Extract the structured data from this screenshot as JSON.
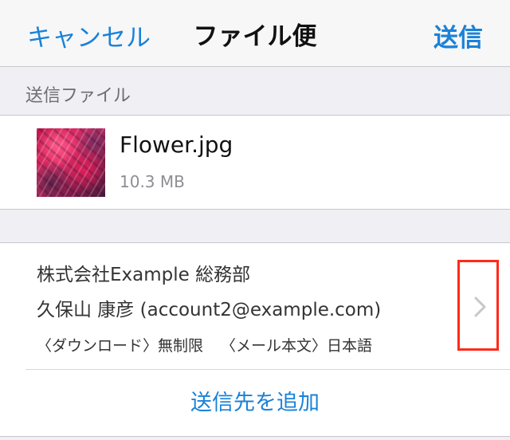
{
  "navbar": {
    "cancel_label": "キャンセル",
    "title": "ファイル便",
    "send_label": "送信"
  },
  "section": {
    "send_files_header": "送信ファイル"
  },
  "file": {
    "name": "Flower.jpg",
    "size": "10.3 MB"
  },
  "recipient": {
    "company": "株式会社Example 総務部",
    "person": "久保山 康彦 (account2@example.com)",
    "download_option": "〈ダウンロード〉無制限",
    "mail_body_option": "〈メール本文〉日本語"
  },
  "actions": {
    "add_recipient_label": "送信先を追加"
  },
  "colors": {
    "accent": "#1a82d8",
    "highlight_border": "#ff2a1a",
    "background": "#efeff4"
  },
  "icons": {
    "disclosure": "chevron-right-icon"
  }
}
